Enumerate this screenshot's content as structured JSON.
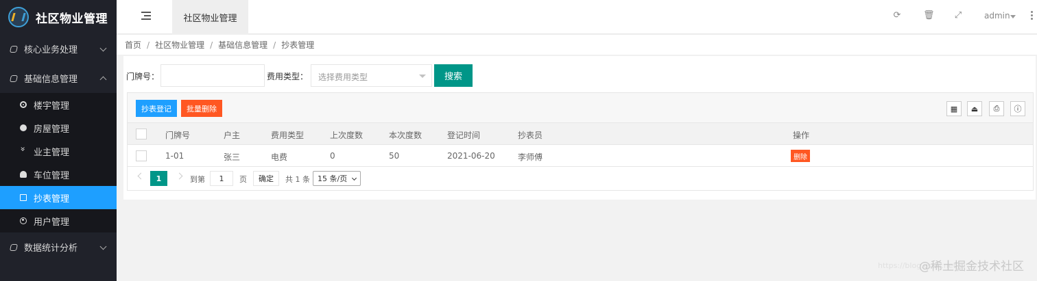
{
  "app": {
    "title": "社区物业管理"
  },
  "sidebar": {
    "groups": [
      {
        "label": "核心业务处理",
        "expanded": false
      },
      {
        "label": "基础信息管理",
        "expanded": true
      },
      {
        "label": "数据统计分析",
        "expanded": false
      }
    ],
    "items": [
      {
        "label": "楼宇管理",
        "icon": "target-icon"
      },
      {
        "label": "房屋管理",
        "icon": "face-icon"
      },
      {
        "label": "业主管理",
        "icon": "chevrons-icon"
      },
      {
        "label": "车位管理",
        "icon": "gauge-icon"
      },
      {
        "label": "抄表管理",
        "icon": "edit-icon",
        "active": true
      },
      {
        "label": "用户管理",
        "icon": "user-icon"
      }
    ]
  },
  "header": {
    "tab": "社区物业管理",
    "user": "admin"
  },
  "breadcrumb": [
    "首页",
    "社区物业管理",
    "基础信息管理",
    "抄表管理"
  ],
  "search": {
    "door_label": "门牌号：",
    "door_value": "",
    "type_label": "费用类型：",
    "type_placeholder": "选择费用类型",
    "button": "搜索"
  },
  "toolbar": {
    "add_label": "抄表登记",
    "batch_delete_label": "批量删除"
  },
  "table": {
    "columns": [
      "门牌号",
      "户主",
      "费用类型",
      "上次度数",
      "本次度数",
      "登记时间",
      "抄表员",
      "操作"
    ],
    "rows": [
      {
        "door": "1-01",
        "owner": "张三",
        "type": "电费",
        "last": "0",
        "current": "50",
        "date": "2021-06-20",
        "reader": "李师傅",
        "action": "删除"
      }
    ]
  },
  "pager": {
    "current": "1",
    "goto_label": "到第",
    "goto_value": "1",
    "page_unit": "页",
    "ok": "确定",
    "total": "共 1 条",
    "page_size": "15 条/页"
  },
  "watermark": {
    "text": "@稀土掘金技术社区",
    "url": "https://blog.csdn.net"
  },
  "colors": {
    "sidebar_bg": "#20222a",
    "active_blue": "#1e9fff",
    "teal": "#009688",
    "danger": "#ff5722"
  }
}
